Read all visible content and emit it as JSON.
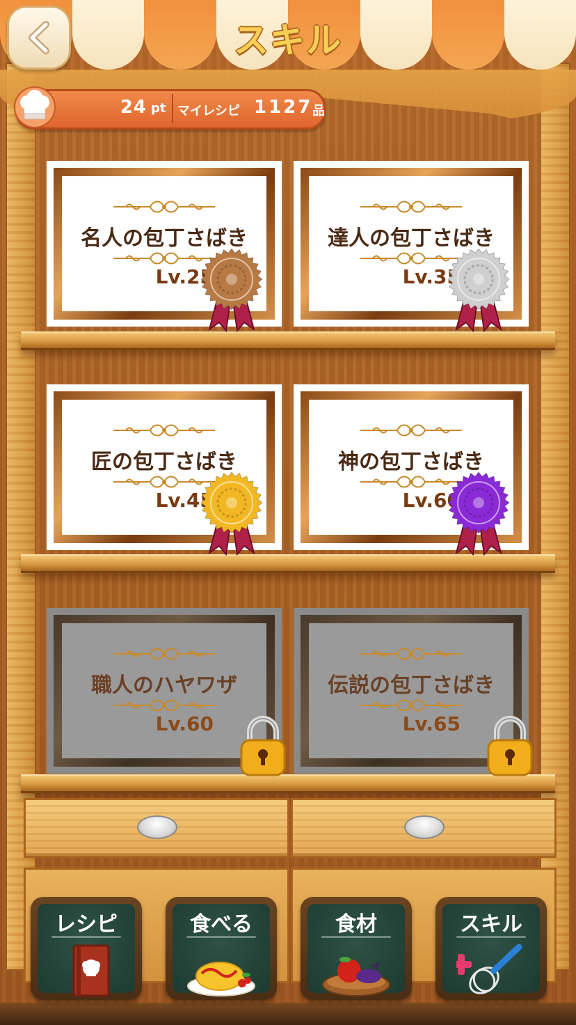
{
  "header": {
    "title": "スキル"
  },
  "points_bar": {
    "points_value": "24",
    "points_unit": "pt",
    "recipe_label": "マイレシピ",
    "recipe_count": "1127",
    "recipe_unit": "品"
  },
  "skills": [
    {
      "name": "名人の包丁さばき",
      "level": "Lv.25",
      "medal": "bronze-medal",
      "locked": false
    },
    {
      "name": "達人の包丁さばき",
      "level": "Lv.35",
      "medal": "silver-medal",
      "locked": false
    },
    {
      "name": "匠の包丁さばき",
      "level": "Lv.45",
      "medal": "gold-medal",
      "locked": false
    },
    {
      "name": "神の包丁さばき",
      "level": "Lv.60",
      "medal": "purple-medal",
      "locked": false
    },
    {
      "name": "職人のハヤワザ",
      "level": "Lv.60",
      "locked": true
    },
    {
      "name": "伝説の包丁さばき",
      "level": "Lv.65",
      "locked": true
    }
  ],
  "colors": {
    "bronze": "#b87a45",
    "silver": "#cfcfcf",
    "gold": "#f2b824",
    "purple": "#8a2ad6",
    "ribbon": "#b0214a"
  },
  "nav": [
    {
      "label": "レシピ",
      "icon": "recipe-book-icon"
    },
    {
      "label": "食べる",
      "icon": "omelette-rice-icon"
    },
    {
      "label": "食材",
      "icon": "ingredients-bowl-icon"
    },
    {
      "label": "スキル",
      "icon": "whisk-icon"
    }
  ]
}
